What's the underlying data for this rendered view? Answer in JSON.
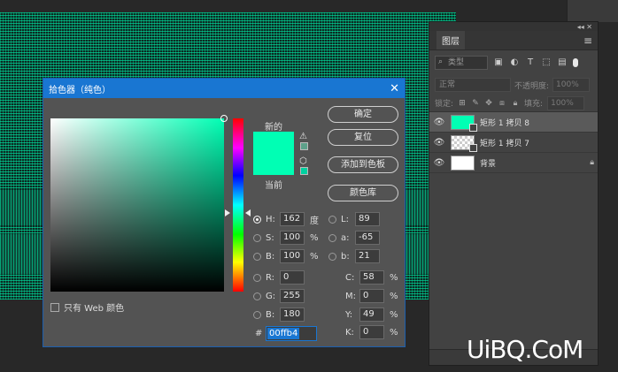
{
  "layers_panel": {
    "tab": "图层",
    "filter_placeholder": "类型",
    "blend_mode": "正常",
    "opacity_label": "不透明度:",
    "opacity_value": "100%",
    "lock_label": "锁定:",
    "fill_label": "填充:",
    "fill_value": "100%",
    "layers": [
      {
        "name": "矩形 1 拷贝 8",
        "selected": true
      },
      {
        "name": "矩形 1 拷贝 7",
        "selected": false
      },
      {
        "name": "背景",
        "selected": false
      }
    ]
  },
  "dialog": {
    "title": "拾色器（纯色）",
    "label_new": "新的",
    "label_current": "当前",
    "buttons": {
      "ok": "确定",
      "reset": "复位",
      "add_swatch": "添加到色板",
      "color_library": "颜色库"
    },
    "web_only": "只有 Web 颜色",
    "hsb": {
      "h_label": "H:",
      "h": "162",
      "h_unit": "度",
      "s_label": "S:",
      "s": "100",
      "s_unit": "%",
      "b_label": "B:",
      "b": "100",
      "b_unit": "%"
    },
    "lab": {
      "l_label": "L:",
      "l": "89",
      "a_label": "a:",
      "a": "-65",
      "b_label": "b:",
      "b": "21"
    },
    "rgb": {
      "r_label": "R:",
      "r": "0",
      "g_label": "G:",
      "g": "255",
      "b_label": "B:",
      "b": "180"
    },
    "cmyk": {
      "c_label": "C:",
      "c": "58",
      "m_label": "M:",
      "m": "0",
      "y_label": "Y:",
      "y": "49",
      "k_label": "K:",
      "k": "0",
      "unit": "%"
    },
    "hex_label": "#",
    "hex": "00ffb4"
  },
  "colors": {
    "selected": "#00ffb4",
    "accent": "#1976d2"
  },
  "watermark": "UiBQ.CoM"
}
